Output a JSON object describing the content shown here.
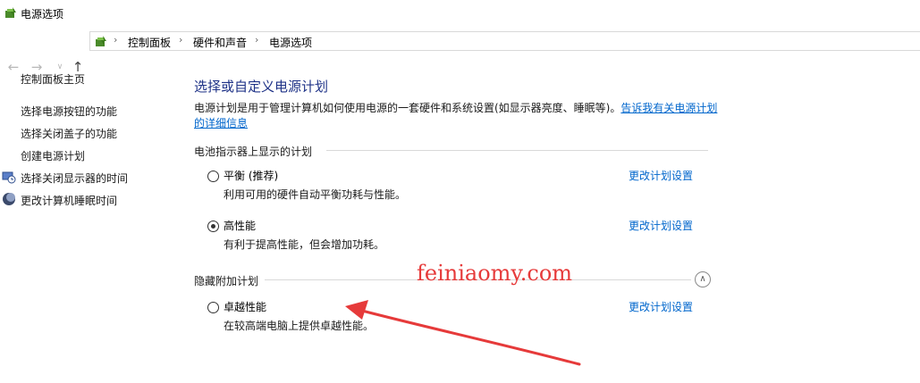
{
  "window": {
    "title": "电源选项",
    "icon": "power-options-icon"
  },
  "nav": {
    "back_icon": "arrow-left-icon",
    "forward_icon": "arrow-right-icon",
    "recent_icon": "chevron-down-icon",
    "up_icon": "arrow-up-icon",
    "breadcrumb": [
      "控制面板",
      "硬件和声音",
      "电源选项"
    ]
  },
  "sidebar": {
    "home": "控制面板主页",
    "links": [
      "选择电源按钮的功能",
      "选择关闭盖子的功能",
      "创建电源计划",
      "选择关闭显示器的时间",
      "更改计算机睡眠时间"
    ]
  },
  "main": {
    "heading": "选择或自定义电源计划",
    "description": "电源计划是用于管理计算机如何使用电源的一套硬件和系统设置(如显示器亮度、睡眠等)。",
    "learn_more_link": "告诉我有关电源计划的详细信息",
    "battery_group": "电池指示器上显示的计划",
    "hidden_group": "隐藏附加计划",
    "change_label": "更改计划设置",
    "plans": [
      {
        "name": "平衡 (推荐)",
        "desc": "利用可用的硬件自动平衡功耗与性能。",
        "selected": false
      },
      {
        "name": "高性能",
        "desc": "有利于提高性能，但会增加功耗。",
        "selected": true
      },
      {
        "name": "卓越性能",
        "desc": "在较高端电脑上提供卓越性能。",
        "selected": false
      }
    ]
  },
  "watermark": "feiniaomy.com",
  "colors": {
    "accent": "#1e3287",
    "link": "#0066cc",
    "annotation": "#e63a3a"
  }
}
